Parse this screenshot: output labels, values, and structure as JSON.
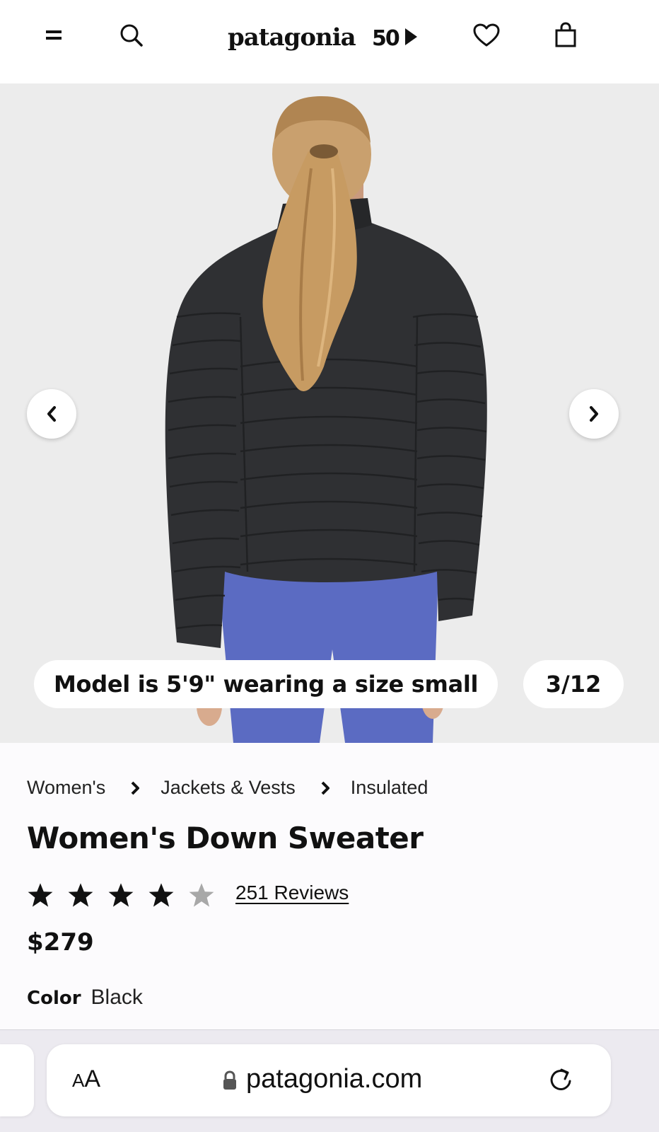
{
  "header": {
    "brand": "patagonia",
    "brand_badge": "50",
    "icons": [
      "menu-icon",
      "search-icon",
      "heart-icon",
      "shopping-bag-icon"
    ]
  },
  "gallery": {
    "caption": "Model is 5'9\" wearing a size small",
    "counter": "3/12",
    "current_index": 3,
    "total": 12,
    "jacket_color": "#2f3033",
    "pants_color": "#5b6bc2",
    "background_color": "#ececec"
  },
  "breadcrumb": [
    "Women's",
    "Jackets & Vests",
    "Insulated"
  ],
  "product": {
    "title": "Women's Down Sweater",
    "rating": 4,
    "rating_max": 5,
    "reviews_label": "251 Reviews",
    "price": "$279",
    "color_label": "Color",
    "color_value": "Black"
  },
  "browser": {
    "text_size_label_small": "A",
    "text_size_label_large": "A",
    "url": "patagonia.com"
  }
}
